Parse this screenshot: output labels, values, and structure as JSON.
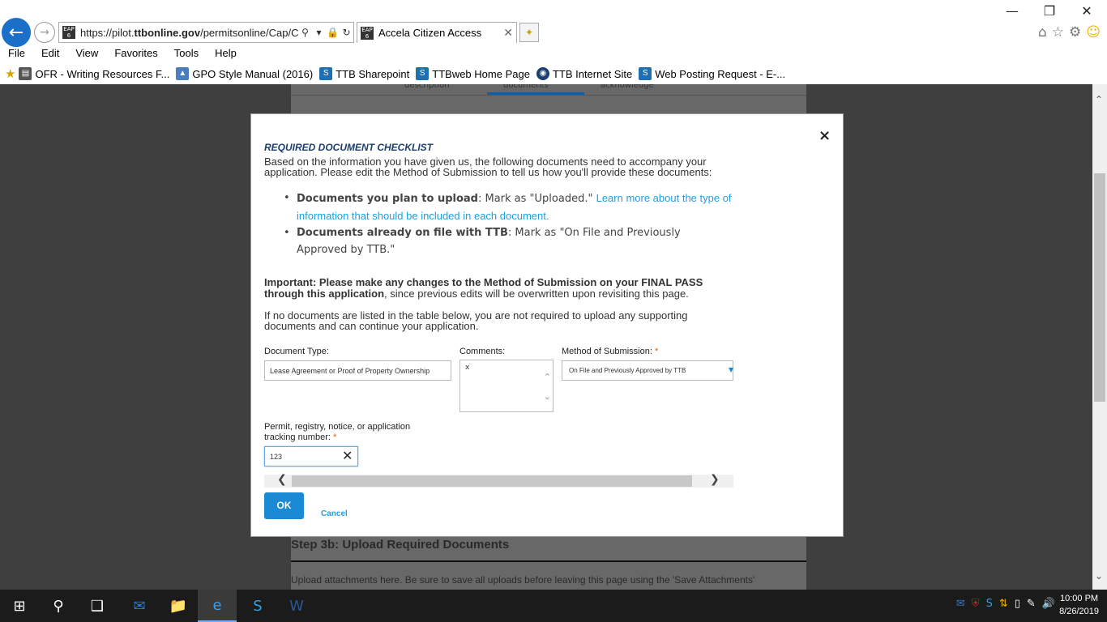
{
  "browser": {
    "url_prefix": "https://pilot.",
    "url_domain": "ttbonline.gov",
    "url_path": "/permitsonline/Cap/Cap",
    "site_icon_text": "EAP 6",
    "tab_title": "Accela Citizen Access",
    "menu": [
      "File",
      "Edit",
      "View",
      "Favorites",
      "Tools",
      "Help"
    ],
    "favorites": [
      {
        "label": "OFR - Writing Resources F...",
        "icon": "document-icon",
        "color": "#555555"
      },
      {
        "label": "GPO Style Manual (2016)",
        "icon": "gpo-icon",
        "color": "#4a7cc0"
      },
      {
        "label": "TTB Sharepoint",
        "icon": "sharepoint-icon",
        "color": "#1f6fb5"
      },
      {
        "label": "TTBweb Home Page",
        "icon": "sharepoint-icon",
        "color": "#1f6fb5"
      },
      {
        "label": "TTB Internet Site",
        "icon": "ttb-seal-icon",
        "color": "#1b3f6e"
      },
      {
        "label": "Web Posting Request - E-...",
        "icon": "sharepoint-icon",
        "color": "#1f6fb5"
      }
    ]
  },
  "background_page": {
    "tabs": [
      "description",
      "documents",
      "acknowledge"
    ],
    "step_title": "Step 3b: Upload Required Documents",
    "step_text": "Upload attachments here. Be sure to save all uploads before leaving this page using the 'Save Attachments'"
  },
  "modal": {
    "close": "×",
    "title": "REQUIRED DOCUMENT CHECKLIST",
    "intro": "Based on the information you have given us, the following documents need to accompany your application. Please edit the Method of Submission to tell us how you'll provide these documents:",
    "bullet1_bold": "Documents you plan to upload",
    "bullet1_text": ": Mark as \"Uploaded.\" ",
    "bullet1_link": "Learn more about the type of information that should be included in each document.",
    "bullet2_bold": "Documents already on file with TTB",
    "bullet2_text": ": Mark as \"On File and Previously Approved by TTB.\"",
    "important_bold": "Important: Please make any changes to the Method of Submission on your FINAL PASS through this application",
    "important_text": ", since previous edits will be overwritten upon revisiting this page.",
    "nodocs": "If no documents are listed in the table below, you are not required to upload any supporting documents and can continue your application.",
    "doc_type_label": "Document Type:",
    "doc_type_value": "Lease Agreement or Proof of Property Ownership",
    "comments_label": "Comments:",
    "comments_value": "x",
    "method_label": "Method of Submission:",
    "method_value": "On File and Previously Approved by TTB",
    "required_mark": "*",
    "tracking_label": "Permit, registry, notice, or application tracking number:",
    "tracking_value": "123",
    "ok": "OK",
    "cancel": "Cancel"
  },
  "taskbar": {
    "time": "10:00 PM",
    "date": "8/26/2019"
  }
}
